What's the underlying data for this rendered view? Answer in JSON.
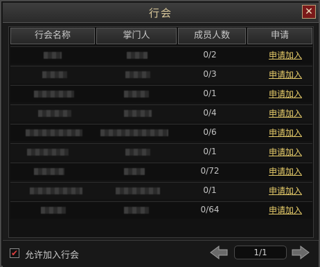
{
  "window": {
    "title": "行会"
  },
  "table": {
    "columns": [
      "行会名称",
      "掌门人",
      "成员人数",
      "申请"
    ],
    "rows": [
      {
        "members": "0/2",
        "action": "申请加入"
      },
      {
        "members": "0/3",
        "action": "申请加入"
      },
      {
        "members": "0/1",
        "action": "申请加入"
      },
      {
        "members": "0/4",
        "action": "申请加入"
      },
      {
        "members": "0/6",
        "action": "申请加入"
      },
      {
        "members": "0/1",
        "action": "申请加入"
      },
      {
        "members": "0/72",
        "action": "申请加入"
      },
      {
        "members": "0/1",
        "action": "申请加入"
      },
      {
        "members": "0/64",
        "action": "申请加入"
      }
    ]
  },
  "footer": {
    "allow_join_label": "允许加入行会",
    "allow_join_checked": true,
    "page_indicator": "1/1"
  },
  "icons": {
    "close": "close-icon",
    "prev": "left-arrow-icon",
    "next": "right-arrow-icon",
    "check": "checkmark-icon"
  },
  "colors": {
    "accent_link": "#e8cd6a",
    "title": "#d8c79a",
    "close_bg": "#7a1a1a",
    "check": "#e04040"
  }
}
